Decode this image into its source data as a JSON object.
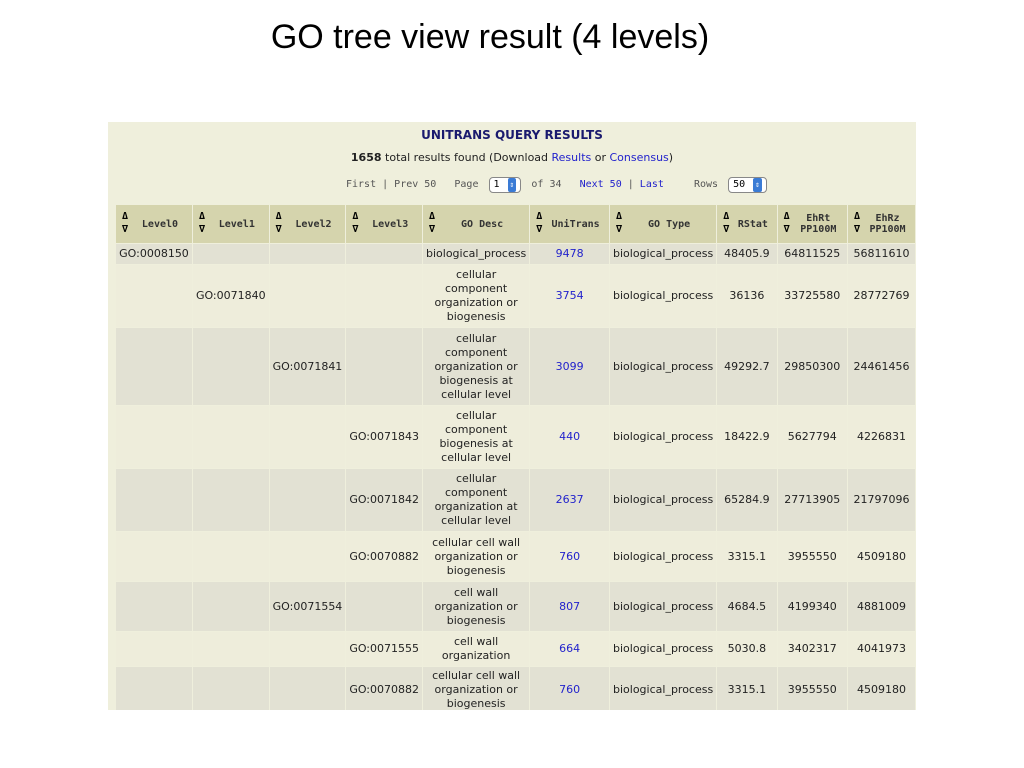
{
  "slide_title": "GO tree view result (4 levels)",
  "panel": {
    "heading": "UNITRANS QUERY RESULTS",
    "total_count": "1658",
    "total_text": " total results found (Download ",
    "results_link": "Results",
    "or_text": " or ",
    "consensus_link": "Consensus",
    "close_paren": ")"
  },
  "pager": {
    "first": "First",
    "sep1": " | ",
    "prev": "Prev 50",
    "page_label": "Page",
    "page_value": "1",
    "of_text": "of 34",
    "next": "Next 50",
    "sep2": " | ",
    "last": "Last",
    "rows_label": "Rows",
    "rows_value": "50"
  },
  "columns": [
    "Level0",
    "Level1",
    "Level2",
    "Level3",
    "GO Desc",
    "UniTrans",
    "GO Type",
    "RStat",
    "EhRt PP100M",
    "EhRz PP100M"
  ],
  "rows": [
    [
      "GO:0008150",
      "",
      "",
      "",
      "biological_process",
      "9478",
      "biological_process",
      "48405.9",
      "64811525",
      "56811610"
    ],
    [
      "",
      "GO:0071840",
      "",
      "",
      "cellular component organization or biogenesis",
      "3754",
      "biological_process",
      "36136",
      "33725580",
      "28772769"
    ],
    [
      "",
      "",
      "GO:0071841",
      "",
      "cellular component organization or biogenesis at cellular level",
      "3099",
      "biological_process",
      "49292.7",
      "29850300",
      "24461456"
    ],
    [
      "",
      "",
      "",
      "GO:0071843",
      "cellular component biogenesis at cellular level",
      "440",
      "biological_process",
      "18422.9",
      "5627794",
      "4226831"
    ],
    [
      "",
      "",
      "",
      "GO:0071842",
      "cellular component organization at cellular level",
      "2637",
      "biological_process",
      "65284.9",
      "27713905",
      "21797096"
    ],
    [
      "",
      "",
      "",
      "GO:0070882",
      "cellular cell wall organization or biogenesis",
      "760",
      "biological_process",
      "3315.1",
      "3955550",
      "4509180"
    ],
    [
      "",
      "",
      "GO:0071554",
      "",
      "cell wall organization or biogenesis",
      "807",
      "biological_process",
      "4684.5",
      "4199340",
      "4881009"
    ],
    [
      "",
      "",
      "",
      "GO:0071555",
      "cell wall organization",
      "664",
      "biological_process",
      "5030.8",
      "3402317",
      "4041973"
    ],
    [
      "",
      "",
      "",
      "GO:0070882",
      "cellular cell wall organization or biogenesis",
      "760",
      "biological_process",
      "3315.1",
      "3955550",
      "4509180"
    ]
  ]
}
